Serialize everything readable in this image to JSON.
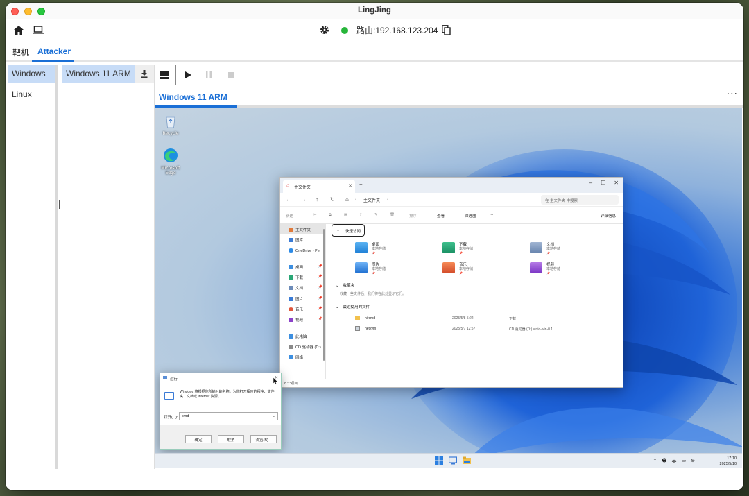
{
  "app": {
    "title": "LingJing"
  },
  "toolbar": {
    "route_text": "路由:192.168.123.204"
  },
  "tabs": [
    {
      "label": "靶机"
    },
    {
      "label": "Attacker"
    }
  ],
  "os_list": [
    {
      "label": "Windows"
    },
    {
      "label": "Linux"
    }
  ],
  "vm_list": [
    {
      "label": "Windows 11 ARM"
    }
  ],
  "vm": {
    "title": "Windows 11 ARM",
    "progress": 0.14
  },
  "desktop": {
    "icons": [
      {
        "label": "Recycle"
      },
      {
        "label": "Microsoft Edge"
      }
    ]
  },
  "explorer": {
    "tab_title": "主文件夹",
    "crumb": "主文件夹",
    "search_placeholder": "在 主文件夹 中搜索",
    "cmd": {
      "new": "新建",
      "sort": "排序",
      "view": "查看",
      "filter": "筛选器",
      "more": "···",
      "details": "详细信息"
    },
    "sidebar": [
      {
        "label": "主文件夹"
      },
      {
        "label": "图库"
      },
      {
        "label": "OneDrive - Per"
      },
      {
        "label": "桌面"
      },
      {
        "label": "下载"
      },
      {
        "label": "文档"
      },
      {
        "label": "图片"
      },
      {
        "label": "音乐"
      },
      {
        "label": "视频"
      },
      {
        "label": "此电脑"
      },
      {
        "label": "CD 驱动器 (D:)"
      },
      {
        "label": "网络"
      }
    ],
    "quick_access": "快速访问",
    "folders": [
      {
        "name": "桌面",
        "sub": "本地存储"
      },
      {
        "name": "下载",
        "sub": "本地存储"
      },
      {
        "name": "文档",
        "sub": "本地存储"
      },
      {
        "name": "图片",
        "sub": "本地存储"
      },
      {
        "name": "音乐",
        "sub": "本地存储"
      },
      {
        "name": "视频",
        "sub": "本地存储"
      }
    ],
    "favorites": "收藏夹",
    "favorites_empty": "收藏一些文件后，我们将在此处显示它们。",
    "recent": "最近使用的文件",
    "recent_files": [
      {
        "name": "nircmd",
        "date": "2025/5/8 5:22",
        "location": "下载"
      },
      {
        "name": "netkvm",
        "date": "2025/5/7 12:57",
        "location": "CD 驱动器 (D:) virtio-win-0.1..."
      }
    ],
    "status": "8 个项目"
  },
  "run_dialog": {
    "title": "运行",
    "description": "Windows 将根据你所输入的名称，为你打开相应的程序、文件夹、文档或 Internet 资源。",
    "open_label": "打开(O):",
    "input_value": "cmd",
    "ok": "确定",
    "cancel": "取消",
    "browse": "浏览(B)..."
  },
  "taskbar": {
    "ime": "英",
    "time": "17:10",
    "date": "2025/5/10"
  },
  "colors": {
    "accent": "#1a6fd6",
    "selected_bg": "#c7dcf7",
    "status_green": "#27b53a"
  }
}
